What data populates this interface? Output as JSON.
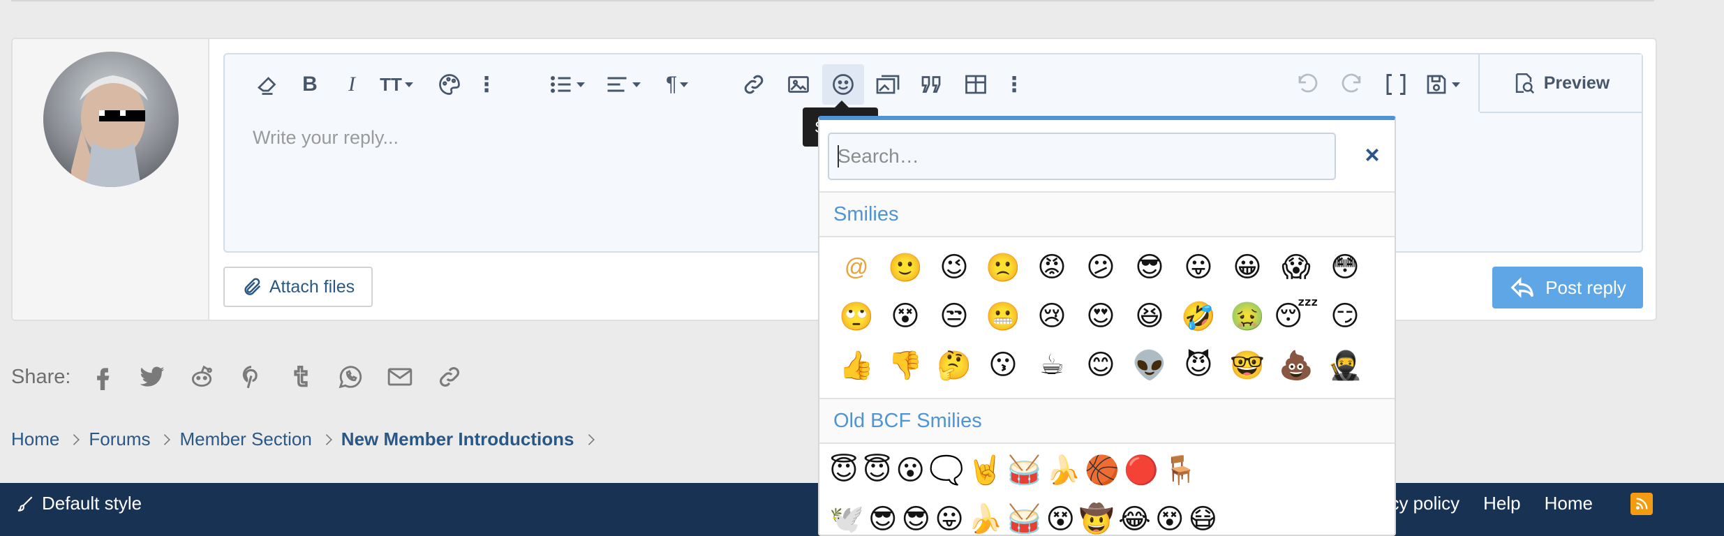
{
  "editor": {
    "placeholder": "Write your reply...",
    "toolbar": {
      "icons": [
        "eraser-icon",
        "bold-icon",
        "italic-icon",
        "text-size-icon",
        "palette-icon",
        "more-icon",
        "list-icon",
        "align-icon",
        "paragraph-icon",
        "link-icon",
        "image-icon",
        "smiley-icon",
        "media-icon",
        "quote-icon",
        "table-icon",
        "more-icon",
        "undo-icon",
        "redo-icon",
        "fullscreen-icon",
        "save-draft-icon"
      ],
      "preview_label": "Preview"
    },
    "tooltip": "Smilies"
  },
  "actions": {
    "attach_label": "Attach files",
    "post_label": "Post reply"
  },
  "smilies_popup": {
    "search_placeholder": "Search…",
    "close_label": "×",
    "section_smilies": "Smilies",
    "section_old": "Old BCF Smilies",
    "smilies": [
      "@",
      "🙂",
      "😉",
      "🙁",
      "😡",
      "😕",
      "😎",
      "😛",
      "😀",
      "😱",
      "😳",
      "🙄",
      "😵",
      "😒",
      "😬",
      "😢",
      "😍",
      "😆",
      "🤣",
      "🤢",
      "😴",
      "😏",
      "👍",
      "👎",
      "🤔",
      "😗",
      "☕",
      "😊",
      "👽",
      "😈",
      "🤓",
      "💩",
      "🥷"
    ],
    "old_smilies_row1": [
      "😇",
      "😇",
      "😮",
      "🗨️",
      "🤘",
      "🥁",
      "🍌",
      "🏀",
      "🔴",
      "🪑"
    ],
    "old_smilies_row2": [
      "🕊️",
      "😎",
      "😎",
      "😛",
      "🍌",
      "🥁",
      "😵",
      "🤠",
      "😂",
      "😵",
      "😷"
    ]
  },
  "share": {
    "label": "Share:",
    "icons": [
      "facebook-icon",
      "twitter-icon",
      "reddit-icon",
      "pinterest-icon",
      "tumblr-icon",
      "whatsapp-icon",
      "email-icon",
      "link-icon"
    ]
  },
  "breadcrumb": {
    "items": [
      "Home",
      "Forums",
      "Member Section",
      "New Member Introductions"
    ]
  },
  "footer": {
    "style_label": "Default style",
    "links": [
      "vacy policy",
      "Help",
      "Home"
    ]
  },
  "colors": {
    "accent": "#4f94d4",
    "post_button": "#5ea6e6",
    "footer_bg": "#183254",
    "link": "#2a5886",
    "rss": "#f39c12"
  }
}
